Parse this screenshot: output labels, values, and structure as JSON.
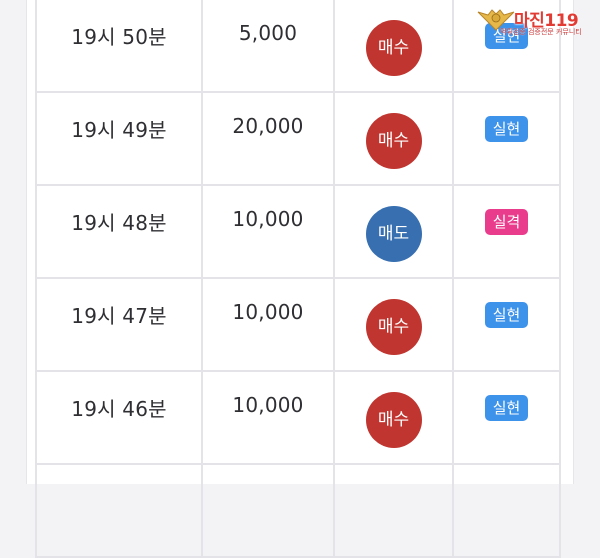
{
  "trades": [
    {
      "time": "19시 50분",
      "amount": "5,000",
      "side": "매수",
      "side_type": "buy",
      "result": "실현",
      "result_type": "hit"
    },
    {
      "time": "19시 49분",
      "amount": "20,000",
      "side": "매수",
      "side_type": "buy",
      "result": "실현",
      "result_type": "hit"
    },
    {
      "time": "19시 48분",
      "amount": "10,000",
      "side": "매도",
      "side_type": "sell",
      "result": "실격",
      "result_type": "miss"
    },
    {
      "time": "19시 47분",
      "amount": "10,000",
      "side": "매수",
      "side_type": "buy",
      "result": "실현",
      "result_type": "hit"
    },
    {
      "time": "19시 46분",
      "amount": "10,000",
      "side": "매수",
      "side_type": "buy",
      "result": "실현",
      "result_type": "hit"
    }
  ],
  "colors": {
    "buy": "#c0352f",
    "sell": "#376fb0",
    "hit": "#3d92ea",
    "miss": "#ea3c8d"
  },
  "watermark": {
    "text": "마진119",
    "subtitle": "먹튀검증 검증전문 커뮤니티",
    "icon": "eagle-shield-logo"
  }
}
